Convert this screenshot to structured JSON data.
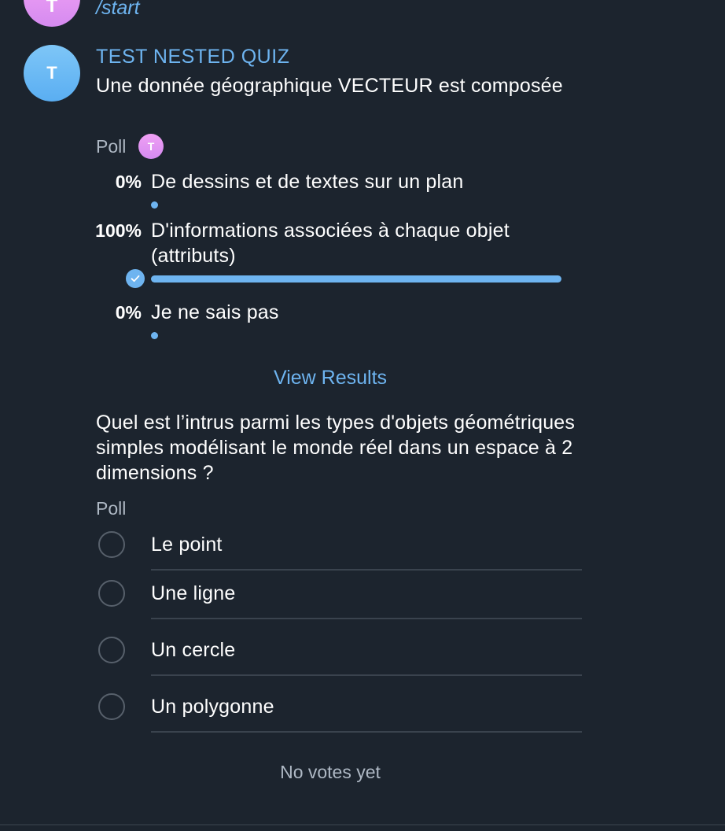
{
  "prev_message": {
    "avatar_letter": "T",
    "command": "/start"
  },
  "message": {
    "avatar_letter": "T",
    "sender": "TEST NESTED QUIZ"
  },
  "poll1": {
    "question": "Une donnée géographique VECTEUR est composée",
    "type_label": "Poll",
    "voter_avatar_letter": "T",
    "options": [
      {
        "percent": "0%",
        "text": "De dessins et de textes sur un plan",
        "value": 0
      },
      {
        "percent": "100%",
        "text": "D'informations associées à chaque objet (attributs)",
        "value": 100,
        "chosen": true
      },
      {
        "percent": "0%",
        "text": "Je ne sais pas",
        "value": 0
      }
    ],
    "view_results_label": "View Results"
  },
  "poll2": {
    "question": "Quel est l’intrus parmi les types d'objets géométriques simples modélisant le monde réel dans un espace à 2 dimensions ?",
    "type_label": "Poll",
    "options": [
      {
        "text": "Le point"
      },
      {
        "text": "Une ligne"
      },
      {
        "text": "Un cercle"
      },
      {
        "text": "Un polygonne"
      }
    ],
    "footer": "No votes yet"
  },
  "colors": {
    "background": "#1c242e",
    "accent": "#6eb4f0",
    "text": "#ffffff",
    "muted": "#aeb8c4"
  }
}
